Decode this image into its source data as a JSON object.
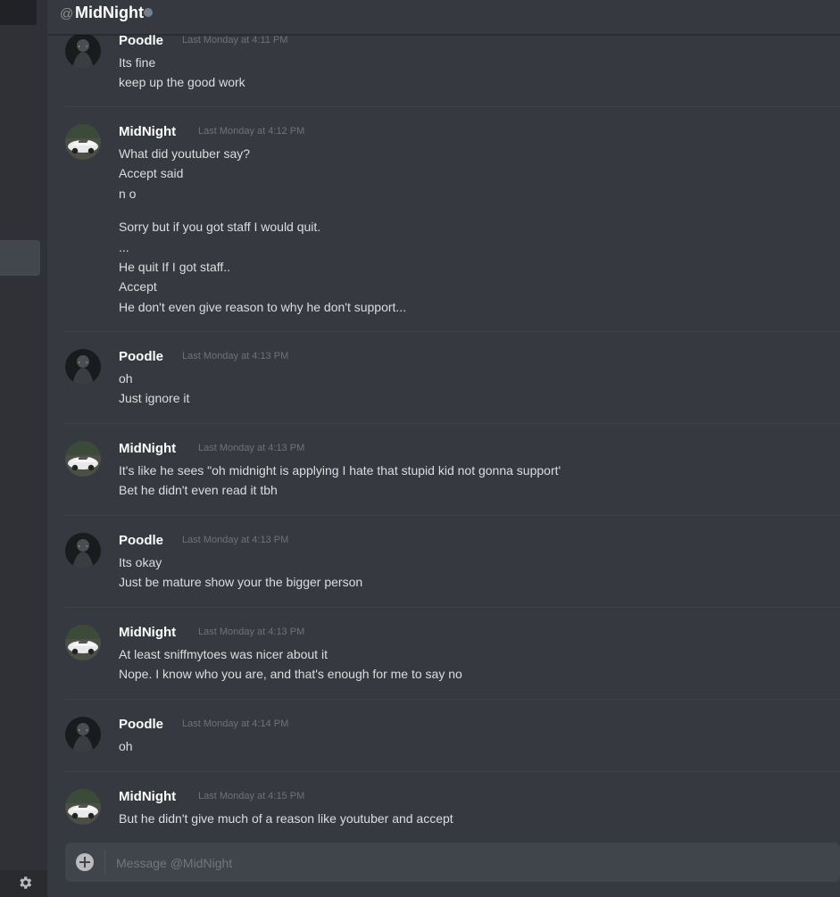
{
  "header": {
    "at_symbol": "@",
    "title": "MidNight"
  },
  "composer": {
    "placeholder": "Message @MidNight"
  },
  "messages": [
    {
      "author": "Poodle",
      "avatar": "poodle",
      "timestamp": "Last Monday at 4:11 PM",
      "lines": [
        "Its fine",
        "keep up the good work"
      ]
    },
    {
      "author": "MidNight",
      "avatar": "car",
      "timestamp": "Last Monday at 4:12 PM",
      "lines": [
        "What did youtuber say?",
        "Accept said",
        "n o",
        "Sorry but if you got staff I would quit.",
        "...",
        "He quit If I got staff..",
        "Accept",
        "He don't even give reason to why he don't support..."
      ]
    },
    {
      "author": "Poodle",
      "avatar": "poodle",
      "timestamp": "Last Monday at 4:13 PM",
      "lines": [
        "oh",
        "Just ignore it"
      ]
    },
    {
      "author": "MidNight",
      "avatar": "car",
      "timestamp": "Last Monday at 4:13 PM",
      "lines": [
        "It's like he sees \"oh midnight is applying I hate that stupid kid not gonna support'",
        "Bet he didn't even read it tbh"
      ]
    },
    {
      "author": "Poodle",
      "avatar": "poodle",
      "timestamp": "Last Monday at 4:13 PM",
      "lines": [
        "Its okay",
        "Just be mature show your the bigger person"
      ]
    },
    {
      "author": "MidNight",
      "avatar": "car",
      "timestamp": "Last Monday at 4:13 PM",
      "lines": [
        "At least sniffmytoes was nicer about it",
        "Nope. I know who you are, and that's enough for me to say no"
      ]
    },
    {
      "author": "Poodle",
      "avatar": "poodle",
      "timestamp": "Last Monday at 4:14 PM",
      "lines": [
        "oh"
      ]
    },
    {
      "author": "MidNight",
      "avatar": "car",
      "timestamp": "Last Monday at 4:15 PM",
      "lines": [
        "But he didn't give much of a reason like youtuber and accept"
      ]
    }
  ],
  "sidebar": {
    "settings_icon": "gear-icon"
  },
  "colors": {
    "background": "#36393f",
    "sidebar": "#2f3136",
    "username": "#ffffff",
    "text": "#dcddde",
    "timestamp": "#72767d"
  }
}
